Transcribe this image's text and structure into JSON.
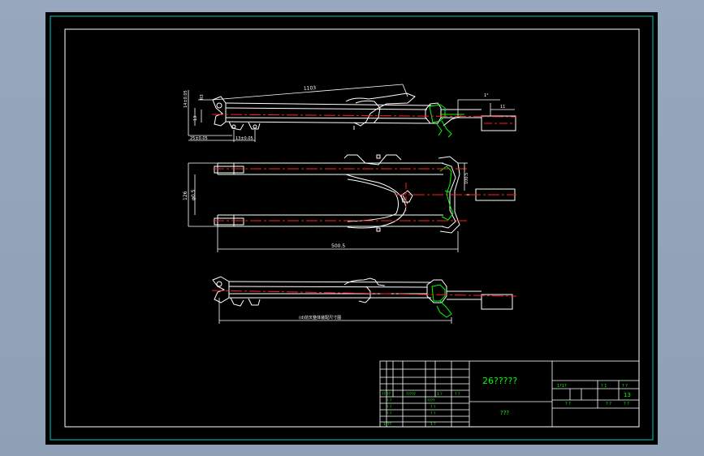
{
  "colors": {
    "background": "#8fa0b6",
    "sheet": "#000000",
    "outer_frame": "#00c8c8",
    "drawing_lines": "#ffffff",
    "centerline": "#ff2020",
    "dimension": "#00ff00",
    "title_text": "#00ff00"
  },
  "icons": [
    "front-fork-top-view",
    "front-fork-front-view",
    "front-fork-bottom-view",
    "title-block"
  ],
  "dimensions": {
    "top_length": "1103",
    "top_left_1": "14±0.05",
    "top_left_2": "R3",
    "top_left_3": "13",
    "top_bottom_left": "25±0.05",
    "top_bottom_mid": "13±0.05",
    "top_right_small": "1°",
    "top_right_len": "11",
    "front_width": "126",
    "front_width_inner": "φ0.5",
    "front_length": "500.5",
    "front_right": "100.5",
    "bottom_label": "(d)前叉整体装配尺寸图"
  },
  "title_block": {
    "drawing_title": "26?????",
    "material": "???",
    "scale_label": "1?1?",
    "sheet_label": "? 1",
    "sheet_of": "? ?",
    "sheet_number": "13",
    "r1": "? ?",
    "r2": "? ?",
    "r3": "? ?",
    "left_rows": [
      [
        "?? ??",
        "?????",
        "1 ?",
        "? ?"
      ],
      [
        "? ?",
        "",
        "????",
        ""
      ],
      [
        "? ?",
        "",
        "? ?",
        ""
      ],
      [
        "? ?",
        "",
        "? ?",
        ""
      ],
      [
        "1???",
        "",
        "1 ?",
        ""
      ]
    ]
  }
}
